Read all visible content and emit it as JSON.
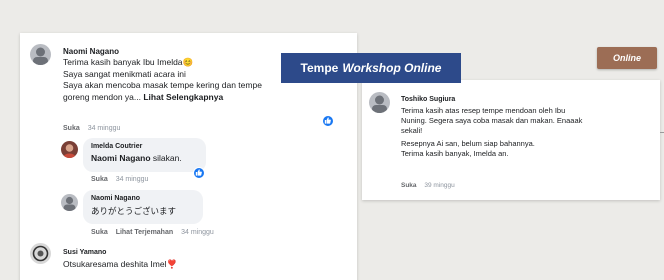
{
  "banner": {
    "title_plain": "Tempe",
    "title_italic": "Workshop Online"
  },
  "online_button": {
    "label": "Online"
  },
  "colors": {
    "banner_bg": "#2d4a8a",
    "online_bg": "#9c6d55",
    "like_blue": "#1877f2"
  },
  "comments": [
    {
      "author": "Naomi Nagano",
      "lines": [
        "Terima kasih banyak Ibu Imelda😊",
        "Saya sangat menikmati acara ini",
        "Saya akan mencoba masak tempe kering dan tempe"
      ],
      "last_line": "goreng mendon ya...",
      "see_more": "Lihat Selengkapnya",
      "like": "Suka",
      "time": "34 minggu"
    },
    {
      "author": "Imelda Coutrier",
      "mention": "Naomi Nagano",
      "text": "silakan.",
      "like": "Suka",
      "time": "34 minggu"
    },
    {
      "author": "Naomi Nagano",
      "text": "ありがとうございます",
      "like": "Suka",
      "translate": "Lihat Terjemahan",
      "time": "34 minggu"
    },
    {
      "author": "Susi Yamano",
      "text": "Otsukaresama deshita Imel❣️"
    },
    {
      "author": "Toshiko Sugiura",
      "lines": [
        "Terima kasih atas resep tempe mendoan oleh Ibu",
        "Nuning. Segera saya coba masak dan makan. Enaaak",
        "sekali!",
        "Resepnya Ai san, belum siap bahannya.",
        "Terima kasih banyak, Imelda an."
      ],
      "like": "Suka",
      "time": "39 minggu"
    }
  ]
}
